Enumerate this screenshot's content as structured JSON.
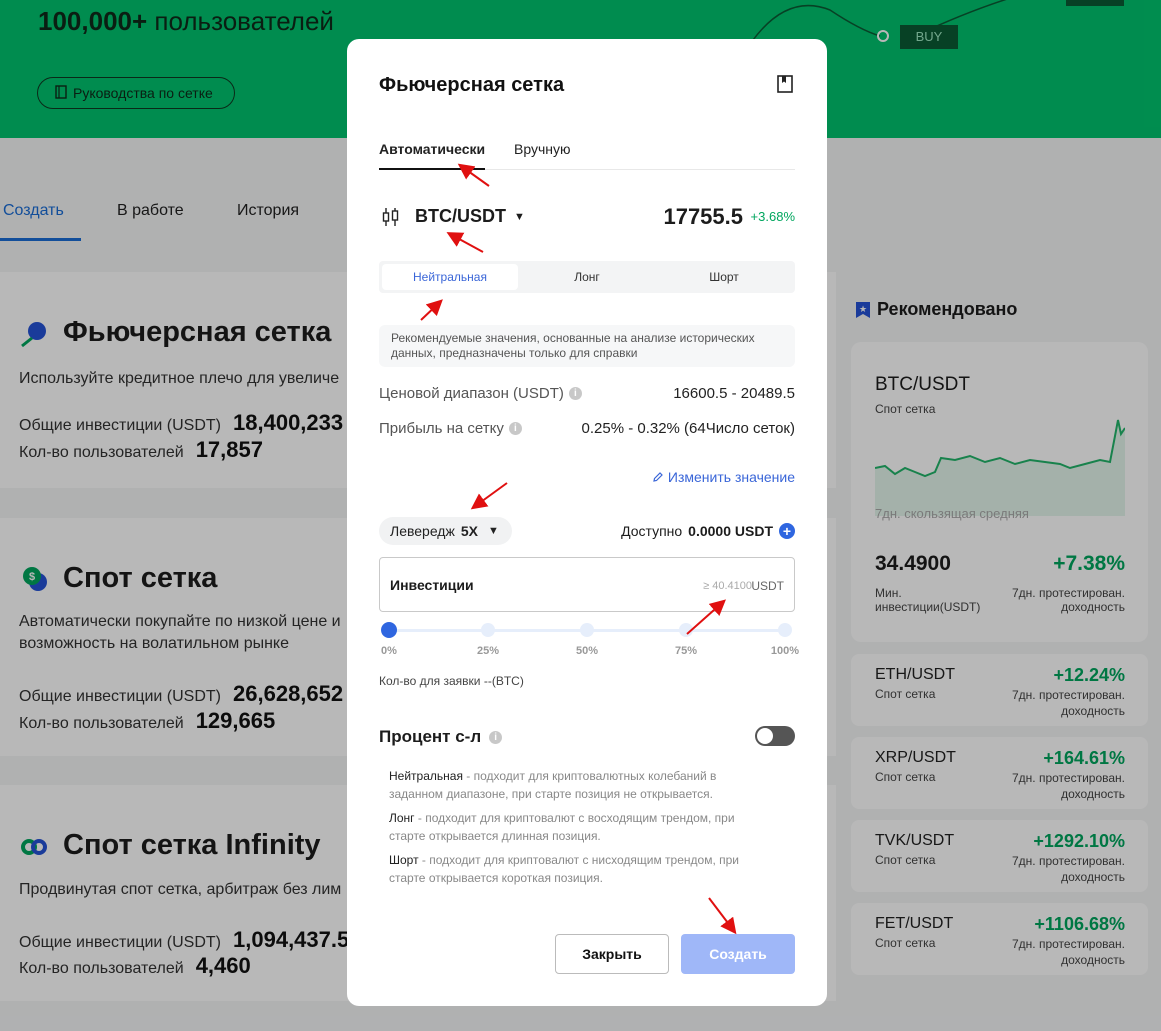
{
  "hero": {
    "users_count": "100,000+",
    "users_text": "пользователей",
    "guide_button": "Руководства по сетке",
    "buy_label": "BUY"
  },
  "tabs": [
    "Создать",
    "В работе",
    "История"
  ],
  "cards": [
    {
      "title": "Фьючерсная сетка",
      "desc": "Используйте кредитное плечо для увеличе",
      "invest_label": "Общие инвестиции (USDT)",
      "invest_value": "18,400,233",
      "users_label": "Кол-во пользователей",
      "users_value": "17,857"
    },
    {
      "title": "Спот сетка",
      "desc1": "Автоматически покупайте по низкой цене и",
      "desc2": "возможность на волатильном рынке",
      "invest_label": "Общие инвестиции (USDT)",
      "invest_value": "26,628,652",
      "users_label": "Кол-во пользователей",
      "users_value": "129,665"
    },
    {
      "title": "Спот сетка Infinity",
      "desc": "Продвинутая спот сетка, арбитраж без лим",
      "invest_label": "Общие инвестиции (USDT)",
      "invest_value": "1,094,437.5",
      "users_label": "Кол-во пользователей",
      "users_value": "4,460"
    }
  ],
  "recommended": {
    "title": "Рекомендовано",
    "main": {
      "pair": "BTC/USDT",
      "type": "Спот сетка",
      "ma_label": "7дн. скользящая средняя",
      "min_invest": "34.4900",
      "min_invest_label1": "Мин.",
      "min_invest_label2": "инвестиции(USDT)",
      "pct": "+7.38%",
      "pct_label1": "7дн. протестирован.",
      "pct_label2": "доходность"
    },
    "items": [
      {
        "pair": "ETH/USDT",
        "type": "Спот сетка",
        "pct": "+12.24%"
      },
      {
        "pair": "XRP/USDT",
        "type": "Спот сетка",
        "pct": "+164.61%"
      },
      {
        "pair": "TVK/USDT",
        "type": "Спот сетка",
        "pct": "+1292.10%"
      },
      {
        "pair": "FET/USDT",
        "type": "Спот сетка",
        "pct": "+1106.68%"
      }
    ],
    "item_label1": "7дн. протестирован.",
    "item_label2": "доходность"
  },
  "modal": {
    "title": "Фьючерсная сетка",
    "mode_tabs": [
      "Автоматически",
      "Вручную"
    ],
    "pair": "BTC/USDT",
    "price": "17755.5",
    "change": "+3.68%",
    "strategies": [
      "Нейтральная",
      "Лонг",
      "Шорт"
    ],
    "note": "Рекомендуемые значения, основанные на анализе исторических данных, предназначены только для справки",
    "price_range_label": "Ценовой диапазон (USDT)",
    "price_range_value": "16600.5 - 20489.5",
    "profit_label": "Прибыль на сетку",
    "profit_value": "0.25% - 0.32% (64Число сеток)",
    "edit_link": "Изменить значение",
    "leverage_label": "Левередж",
    "leverage_value": "5X",
    "available_label": "Доступно",
    "available_value": "0.0000 USDT",
    "invest_label": "Инвестиции",
    "invest_placeholder": "≥ 40.4100",
    "invest_unit": "USDT",
    "slider_labels": [
      "0%",
      "25%",
      "50%",
      "75%",
      "100%"
    ],
    "slider_value_pct": 0,
    "qty_label": "Кол-во для заявки",
    "qty_value": "--(BTC)",
    "tpsl_label": "Процент с-л",
    "tpsl_enabled": false,
    "explanations": [
      {
        "term": "Нейтральная",
        "text": " - подходит для криптовалютных колебаний в заданном диапазоне, при старте позиция не открывается."
      },
      {
        "term": "Лонг",
        "text": " - подходит для криптовалют с восходящим трендом, при старте открывается длинная позиция."
      },
      {
        "term": "Шорт",
        "text": " - подходит для криптовалют с нисходящим трендом, при старте открывается короткая позиция."
      }
    ],
    "close_button": "Закрыть",
    "create_button": "Создать"
  },
  "colors": {
    "brand_green": "#00c36e",
    "accent_blue": "#3a66d8",
    "positive": "#00a65e",
    "create_disabled": "#9fb7f8"
  }
}
